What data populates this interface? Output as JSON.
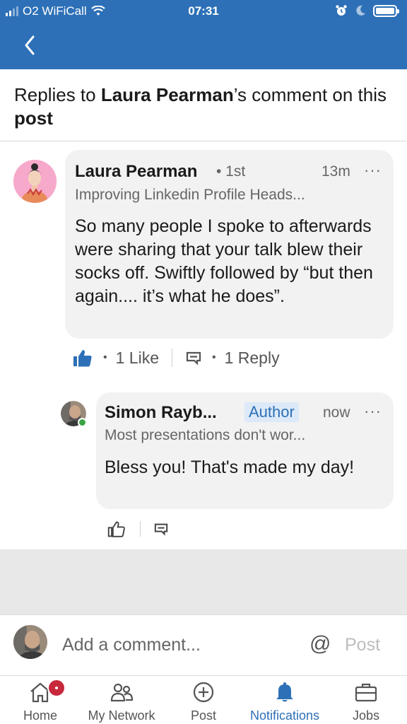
{
  "status_bar": {
    "carrier": "O2 WiFiCall",
    "time": "07:31"
  },
  "header": {
    "prefix": "Replies to ",
    "author": "Laura Pearman",
    "middle": "’s comment on this ",
    "post_word": "post"
  },
  "comment": {
    "author": "Laura Pearman",
    "degree": "• 1st",
    "time": "13m",
    "more": "···",
    "headline": "Improving Linkedin Profile Heads...",
    "body": "So many people I spoke to afterwards were sharing that your talk blew their socks off. Swiftly followed by “but then again.... it’s what he does”.",
    "likes_label": "1 Like",
    "replies_label": "1 Reply",
    "dot": "•"
  },
  "reply": {
    "author": "Simon Rayb...",
    "badge": "Author",
    "time": "now",
    "more": "···",
    "headline": "Most presentations don't wor...",
    "body": "Bless you!  That's made my day!"
  },
  "comment_bar": {
    "placeholder": "Add a comment...",
    "at_symbol": "@",
    "post_label": "Post"
  },
  "bottom_nav": {
    "items": [
      {
        "label": "Home",
        "icon": "home-icon"
      },
      {
        "label": "My Network",
        "icon": "network-icon"
      },
      {
        "label": "Post",
        "icon": "post-icon"
      },
      {
        "label": "Notifications",
        "icon": "bell-icon"
      },
      {
        "label": "Jobs",
        "icon": "briefcase-icon"
      }
    ],
    "active": "Notifications"
  },
  "colors": {
    "brand_blue": "#2d70b7",
    "bubble_bg": "#f2f2f2",
    "notification_badge": "#c8283c",
    "online_dot": "#3aa543"
  }
}
